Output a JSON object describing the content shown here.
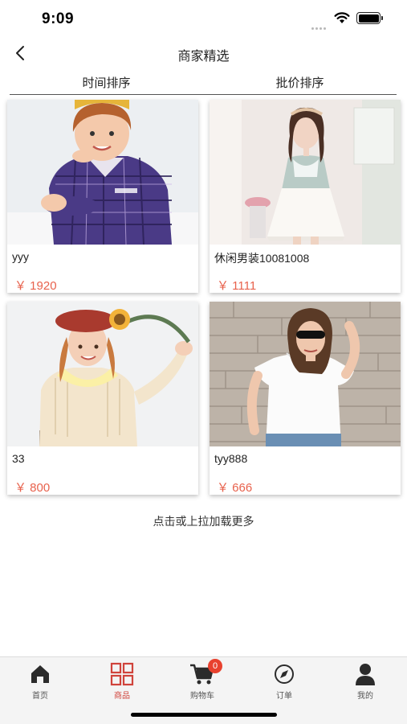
{
  "status_bar": {
    "time": "9:09"
  },
  "nav": {
    "title": "商家精选"
  },
  "sort_tabs": [
    {
      "label": "时间排序"
    },
    {
      "label": "批价排序"
    }
  ],
  "products": [
    {
      "name": "yyy",
      "price": "￥ 1920",
      "image": "child-plaid-shirt"
    },
    {
      "name": "休闲男装10081008",
      "price": "￥ 1111",
      "image": "woman-white-dress"
    },
    {
      "name": "33",
      "price": "￥ 800",
      "image": "girl-beret-cardigan"
    },
    {
      "name": "tyy888",
      "price": "￥ 666",
      "image": "woman-white-tshirt"
    }
  ],
  "load_more": "点击或上拉加载更多",
  "tab_bar": {
    "items": [
      {
        "label": "首页",
        "icon": "home-icon"
      },
      {
        "label": "商品",
        "icon": "grid-icon",
        "active": true
      },
      {
        "label": "购物车",
        "icon": "cart-icon",
        "badge": "0"
      },
      {
        "label": "订单",
        "icon": "compass-icon"
      },
      {
        "label": "我的",
        "icon": "user-icon"
      }
    ]
  },
  "colors": {
    "accent": "#d0433b",
    "price": "#e8624d",
    "badge": "#e8412e"
  }
}
